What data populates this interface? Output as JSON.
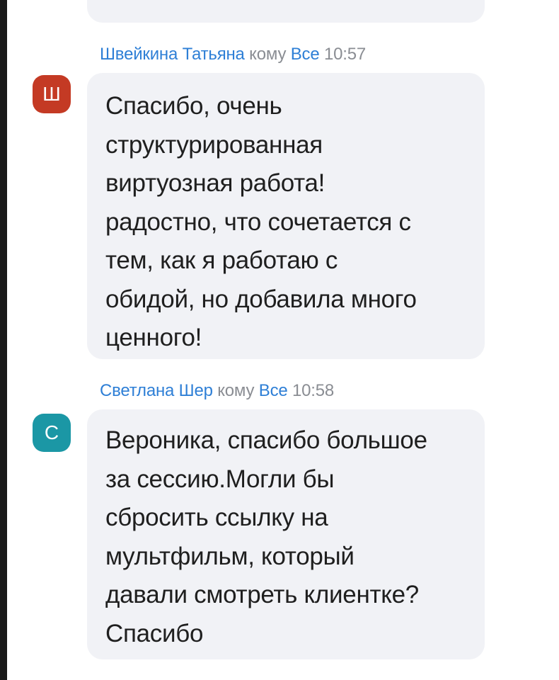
{
  "messages": [
    {
      "sender": "Швейкина Татьяна",
      "to_word": "кому",
      "recipient": "Все",
      "time": "10:57",
      "avatar_letter": "Ш",
      "avatar_color": "#c43a24",
      "text": "Спасибо, очень\nструктурированная\nвиртуозная работа!\nрадостно, что сочетается с\nтем, как я работаю с\nобидой, но добавила много\nценного!"
    },
    {
      "sender": "Светлана Шер",
      "to_word": "кому",
      "recipient": "Все",
      "time": "10:58",
      "avatar_letter": "С",
      "avatar_color": "#1b97a5",
      "text": "Вероника, спасибо большое\nза сессию.Могли бы\nсбросить ссылку на\nмультфильм, который\nдавали смотреть клиентке?\nСпасибо"
    }
  ],
  "colors": {
    "sender_name": "#2e7fd6",
    "meta_gray": "#8a8d93",
    "bubble_bg": "#f1f2f6"
  }
}
